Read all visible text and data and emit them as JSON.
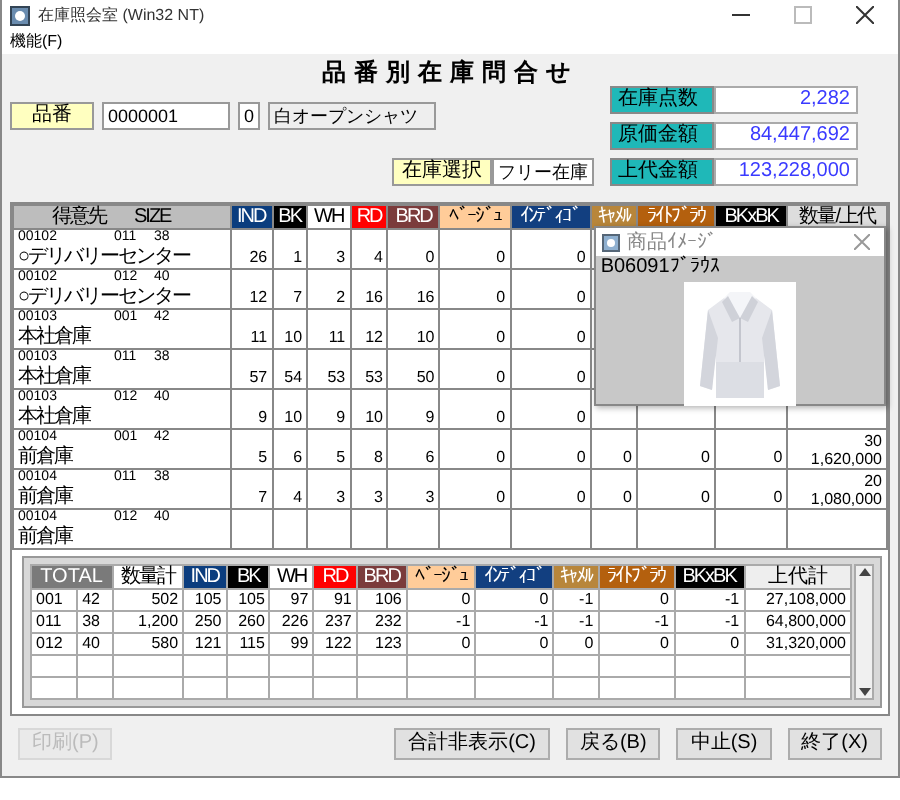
{
  "window": {
    "title": "在庫照会室 (Win32 NT)"
  },
  "menu": [
    {
      "label": "機能(F)"
    }
  ],
  "form_title": "品番別在庫問合せ",
  "item": {
    "label": "品番",
    "code": "0000001",
    "color_code": "0",
    "name": "白オープンシャツ"
  },
  "stock_select": {
    "label": "在庫選択",
    "value": "フリー在庫"
  },
  "summary": [
    {
      "label": "在庫点数",
      "value": "2,282"
    },
    {
      "label": "原価金額",
      "value": "84,447,692"
    },
    {
      "label": "上代金額",
      "value": "123,228,000"
    }
  ],
  "grid": {
    "key_headers": [
      "得意先",
      "SIZE"
    ],
    "color_columns": [
      {
        "label": "IND",
        "color": "#0b3d7e"
      },
      {
        "label": "BK",
        "color": "#000000"
      },
      {
        "label": "WH",
        "color": "#ffffff"
      },
      {
        "label": "RD",
        "color": "#ff0000"
      },
      {
        "label": "BRD",
        "color": "#7b3b3b"
      },
      {
        "label": "ﾍﾞｰｼﾞｭ",
        "color": "#ffcc99"
      },
      {
        "label": "ｲﾝﾃﾞｨｺﾞ",
        "color": "#123f80"
      },
      {
        "label": "ｷｬﾒﾙ",
        "color": "#b8863b"
      },
      {
        "label": "ﾗｲﾄﾌﾞﾗｳ",
        "color": "#b4600e"
      },
      {
        "label": "BKxBK",
        "color": "#000000"
      }
    ],
    "total_header": "数量/上代",
    "rows": [
      {
        "customer_code": "00102",
        "size_code": "011",
        "size": "38",
        "customer_name": "○デリバリーセンター",
        "values": [
          "26",
          "1",
          "3",
          "4",
          "0",
          "0",
          "0"
        ]
      },
      {
        "customer_code": "00102",
        "size_code": "012",
        "size": "40",
        "customer_name": "○デリバリーセンター",
        "values": [
          "12",
          "7",
          "2",
          "16",
          "16",
          "0",
          "0"
        ]
      },
      {
        "customer_code": "00103",
        "size_code": "001",
        "size": "42",
        "customer_name": "本社倉庫",
        "values": [
          "11",
          "10",
          "11",
          "12",
          "10",
          "0",
          "0"
        ]
      },
      {
        "customer_code": "00103",
        "size_code": "011",
        "size": "38",
        "customer_name": "本社倉庫",
        "values": [
          "57",
          "54",
          "53",
          "53",
          "50",
          "0",
          "0"
        ]
      },
      {
        "customer_code": "00103",
        "size_code": "012",
        "size": "40",
        "customer_name": "本社倉庫",
        "values": [
          "9",
          "10",
          "9",
          "10",
          "9",
          "0",
          "0"
        ]
      },
      {
        "customer_code": "00104",
        "size_code": "001",
        "size": "42",
        "customer_name": "前倉庫",
        "values": [
          "5",
          "6",
          "5",
          "8",
          "6",
          "0",
          "0",
          "0",
          "0",
          "0"
        ],
        "quantity": "30",
        "amount": "1,620,000"
      },
      {
        "customer_code": "00104",
        "size_code": "011",
        "size": "38",
        "customer_name": "前倉庫",
        "values": [
          "7",
          "4",
          "3",
          "3",
          "3",
          "0",
          "0",
          "0",
          "0",
          "0"
        ],
        "quantity": "20",
        "amount": "1,080,000"
      },
      {
        "customer_code": "00104",
        "size_code": "012",
        "size": "40",
        "customer_name": "前倉庫",
        "values": []
      }
    ]
  },
  "image_window": {
    "title": "商品ｲﾒｰｼﾞ",
    "caption": "B06091ﾌﾞﾗｳｽ"
  },
  "totals": {
    "title": "TOTAL",
    "quantity_header": "数量計",
    "color_columns": [
      {
        "label": "IND",
        "color": "#0b3d7e"
      },
      {
        "label": "BK",
        "color": "#000000"
      },
      {
        "label": "WH",
        "color": "#ffffff"
      },
      {
        "label": "RD",
        "color": "#ff0000"
      },
      {
        "label": "BRD",
        "color": "#7b3b3b"
      },
      {
        "label": "ﾍﾞｰｼﾞｭ",
        "color": "#ffcc99"
      },
      {
        "label": "ｲﾝﾃﾞｨｺﾞ",
        "color": "#123f80"
      },
      {
        "label": "ｷｬﾒﾙ",
        "color": "#b8863b"
      },
      {
        "label": "ﾗｲﾄﾌﾞﾗｳ",
        "color": "#b4600e"
      },
      {
        "label": "BKxBK",
        "color": "#000000"
      }
    ],
    "amount_header": "上代計",
    "rows": [
      {
        "size_code": "001",
        "size": "42",
        "quantity": "502",
        "values": [
          "105",
          "105",
          "97",
          "91",
          "106",
          "0",
          "0",
          "-1",
          "0",
          "-1"
        ],
        "amount": "27,108,000"
      },
      {
        "size_code": "011",
        "size": "38",
        "quantity": "1,200",
        "values": [
          "250",
          "260",
          "226",
          "237",
          "232",
          "-1",
          "-1",
          "-1",
          "-1",
          "-1"
        ],
        "amount": "64,800,000"
      },
      {
        "size_code": "012",
        "size": "40",
        "quantity": "580",
        "values": [
          "121",
          "115",
          "99",
          "122",
          "123",
          "0",
          "0",
          "0",
          "0",
          "0"
        ],
        "amount": "31,320,000"
      }
    ]
  },
  "buttons": [
    {
      "label": "印刷(P)",
      "disabled": true
    },
    {
      "label": "合計非表示(C)",
      "disabled": false
    },
    {
      "label": "戻る(B)",
      "disabled": false
    },
    {
      "label": "中止(S)",
      "disabled": false
    },
    {
      "label": "終了(X)",
      "disabled": false
    }
  ]
}
